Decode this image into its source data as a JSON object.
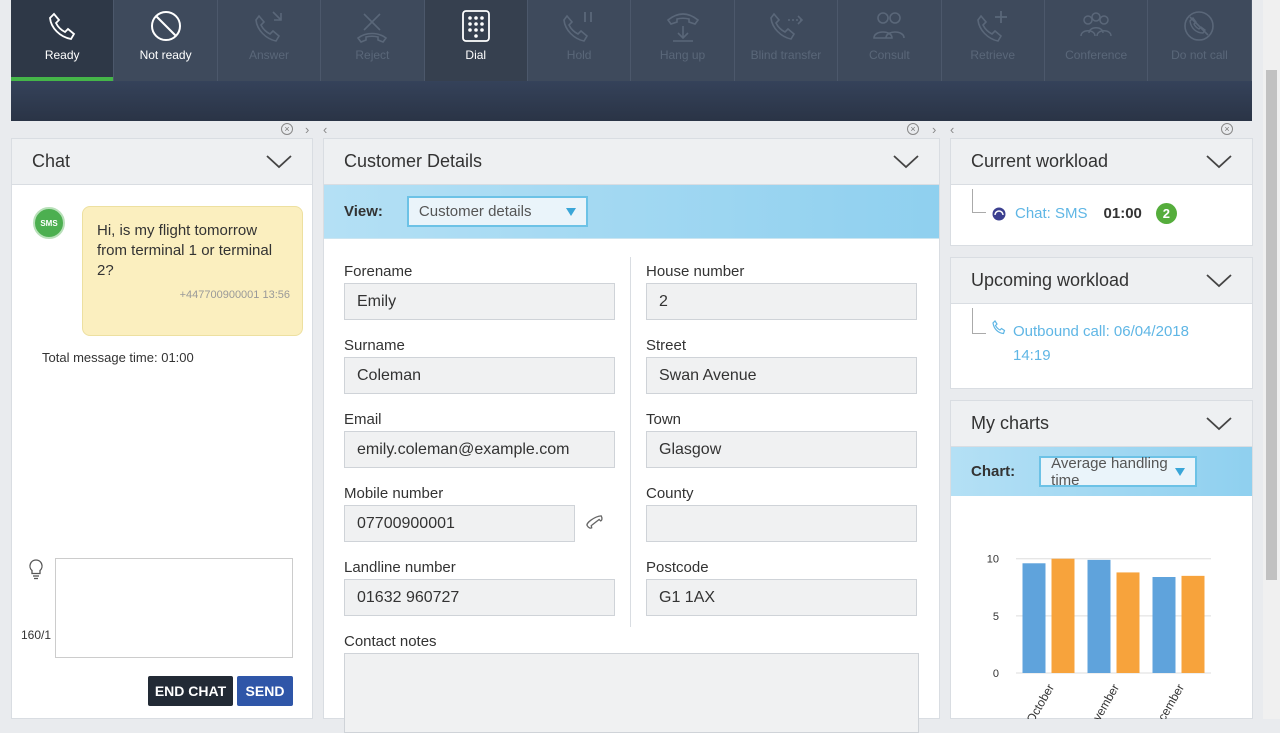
{
  "toolbar": {
    "buttons": [
      {
        "label": "Ready",
        "icon": "phone-icon",
        "state": "active"
      },
      {
        "label": "Not ready",
        "icon": "not-ready-icon",
        "state": "enabled"
      },
      {
        "label": "Answer",
        "icon": "answer-icon",
        "state": "disabled"
      },
      {
        "label": "Reject",
        "icon": "reject-icon",
        "state": "disabled"
      },
      {
        "label": "Dial",
        "icon": "dialpad-icon",
        "state": "enabled"
      },
      {
        "label": "Hold",
        "icon": "hold-icon",
        "state": "disabled"
      },
      {
        "label": "Hang up",
        "icon": "hang-up-icon",
        "state": "disabled"
      },
      {
        "label": "Blind transfer",
        "icon": "blind-transfer-icon",
        "state": "disabled"
      },
      {
        "label": "Consult",
        "icon": "consult-icon",
        "state": "disabled"
      },
      {
        "label": "Retrieve",
        "icon": "retrieve-icon",
        "state": "disabled"
      },
      {
        "label": "Conference",
        "icon": "conference-icon",
        "state": "disabled"
      },
      {
        "label": "Do not call",
        "icon": "do-not-call-icon",
        "state": "disabled"
      }
    ]
  },
  "chat": {
    "title": "Chat",
    "sms_label": "SMS",
    "message": "Hi, is my flight tomorrow from terminal 1 or terminal 2?",
    "message_meta": "+447700900001 13:56",
    "total_time": "Total message time: 01:00",
    "counter": "160/1",
    "end_label": "END CHAT",
    "send_label": "SEND"
  },
  "customer": {
    "title": "Customer Details",
    "view_label": "View:",
    "view_value": "Customer details",
    "fields": {
      "forename": {
        "label": "Forename",
        "value": "Emily"
      },
      "surname": {
        "label": "Surname",
        "value": "Coleman"
      },
      "email": {
        "label": "Email",
        "value": "emily.coleman@example.com"
      },
      "mobile": {
        "label": "Mobile number",
        "value": "07700900001"
      },
      "landline": {
        "label": "Landline number",
        "value": "01632 960727"
      },
      "house": {
        "label": "House number",
        "value": "2"
      },
      "street": {
        "label": "Street",
        "value": "Swan Avenue"
      },
      "town": {
        "label": "Town",
        "value": "Glasgow"
      },
      "county": {
        "label": "County",
        "value": ""
      },
      "postcode": {
        "label": "Postcode",
        "value": "G1 1AX"
      }
    },
    "notes_label": "Contact notes",
    "notes_value": ""
  },
  "current": {
    "title": "Current workload",
    "item_label": "Chat: SMS",
    "item_time": "01:00",
    "item_count": "2"
  },
  "upcoming": {
    "title": "Upcoming workload",
    "item_label": "Outbound call: 06/04/2018 14:19"
  },
  "charts": {
    "title": "My charts",
    "chart_label": "Chart:",
    "chart_value": "Average handling time"
  },
  "colors": {
    "series_a": "#5fa3dc",
    "series_b": "#f7a33c",
    "accent": "#45b649"
  },
  "chart_data": {
    "type": "bar",
    "categories": [
      "October",
      "November",
      "December"
    ],
    "series": [
      {
        "values": [
          9.6,
          9.9,
          8.4
        ]
      },
      {
        "values": [
          10.0,
          8.8,
          8.5
        ]
      }
    ],
    "yticks": [
      0,
      5,
      10
    ],
    "ylim": [
      0,
      10.5
    ],
    "grid": true
  }
}
